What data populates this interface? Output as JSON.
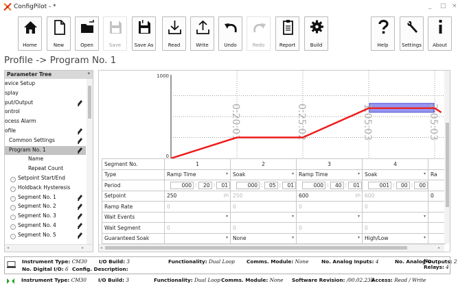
{
  "window": {
    "title": "ConfigPilot - *",
    "minimize": "_",
    "maximize": "□",
    "close": "×"
  },
  "toolbar": {
    "home": "Home",
    "new": "New",
    "open": "Open",
    "save": "Save",
    "save_as": "Save As",
    "read": "Read",
    "write": "Write",
    "undo": "Undo",
    "redo": "Redo",
    "report": "Report",
    "build": "Build",
    "help": "Help",
    "settings": "Settings",
    "about": "About"
  },
  "page_title": "Profile -> Program No. 1",
  "tree": {
    "header": "Parameter Tree",
    "pin": "ᵠ",
    "items": [
      {
        "label": "evice Setup",
        "editable": false
      },
      {
        "label": "splay",
        "editable": false
      },
      {
        "label": "put/Output",
        "editable": true
      },
      {
        "label": "ontrol",
        "editable": false
      },
      {
        "label": "ocess Alarm",
        "editable": false
      },
      {
        "label": "ofile",
        "editable": true
      },
      {
        "label": "Common Settings",
        "editable": true
      },
      {
        "label": "Program No. 1",
        "editable": true,
        "selected": true
      },
      {
        "label": "Name",
        "editable": false
      },
      {
        "label": "Repeat Count",
        "editable": false
      },
      {
        "label": "Setpoint Start/End",
        "editable": false,
        "expander": true
      },
      {
        "label": "Holdback Hysteresis",
        "editable": false,
        "expander": true
      },
      {
        "label": "Segment No. 1",
        "editable": true,
        "expander": true
      },
      {
        "label": "Segment No. 2",
        "editable": true,
        "expander": true
      },
      {
        "label": "Segment No. 3",
        "editable": true,
        "expander": true
      },
      {
        "label": "Segment No. 4",
        "editable": true,
        "expander": true
      },
      {
        "label": "Segment No. 5",
        "editable": true,
        "expander": true
      }
    ]
  },
  "chart_data": {
    "type": "line",
    "y_top_label": "1000",
    "y_bottom_label": "0",
    "series": [
      {
        "x": [
          0,
          1,
          2,
          3,
          4,
          4.1
        ],
        "y": [
          0,
          250,
          250,
          600,
          600,
          550
        ]
      }
    ],
    "x_tick_labels": [
      "0:20:01",
      "0:25:02",
      "1:05:03",
      "2:05:03"
    ],
    "highlight_segment": 4
  },
  "grid": {
    "row_headers": [
      "Segment No.",
      "Type",
      "Period",
      "Setpoint",
      "Ramp Rate",
      "Wait Events",
      "Wait Segment",
      "Guaranteed Soak"
    ],
    "columns": [
      {
        "no": "1",
        "type": "Ramp Time",
        "period": [
          "000",
          "20",
          "01"
        ],
        "setpoint": "250",
        "setpoint_unit": "l/h",
        "ramp_rate": "0",
        "wait_events": "",
        "wait_segment": "0",
        "guaranteed_soak": ""
      },
      {
        "no": "2",
        "type": "Soak",
        "period": [
          "000",
          "05",
          "01"
        ],
        "setpoint": "250",
        "setpoint_unit": "",
        "ramp_rate": "0",
        "wait_events": "",
        "wait_segment": "0",
        "guaranteed_soak": "None"
      },
      {
        "no": "3",
        "type": "Ramp Time",
        "period": [
          "000",
          "40",
          "01"
        ],
        "setpoint": "600",
        "setpoint_unit": "l/h",
        "ramp_rate": "0",
        "wait_events": "",
        "wait_segment": "0",
        "guaranteed_soak": ""
      },
      {
        "no": "4",
        "type": "Soak",
        "period": [
          "001",
          "00",
          "00"
        ],
        "setpoint": "600",
        "setpoint_unit": "",
        "ramp_rate": "0",
        "wait_events": "",
        "wait_segment": "0",
        "guaranteed_soak": "High/Low"
      },
      {
        "no": "",
        "type": "Ra",
        "period": [
          "",
          "",
          ""
        ],
        "setpoint": "0",
        "setpoint_unit": "",
        "ramp_rate": "",
        "wait_events": "",
        "wait_segment": "",
        "guaranteed_soak": ""
      }
    ]
  },
  "status1": {
    "instrument_type_label": "Instrument Type:",
    "instrument_type": "CM30",
    "io_build_label": "I/O Build:",
    "io_build": "3",
    "functionality_label": "Functionality:",
    "functionality": "Dual Loop",
    "comms_label": "Comms. Module:",
    "comms": "None",
    "analog_inputs_label": "No. Analog Inputs:",
    "analog_inputs": "4",
    "analog_outputs_label": "No. Analog Outputs:",
    "analog_outputs": "2",
    "relays_label": "No. Relays:",
    "relays": "4",
    "digital_io_label": "No. Digital I/O:",
    "digital_io": "6",
    "config_desc_label": "Config. Description:"
  },
  "status2": {
    "instrument_type_label": "Instrument Type:",
    "instrument_type": "CM30",
    "io_build_label": "I/O Build:",
    "io_build": "3",
    "functionality_label": "Functionality:",
    "functionality": "Dual Loop",
    "comms_label": "Comms. Module:",
    "comms": "None",
    "software_label": "Software Revision:",
    "software": "/00.02.23E",
    "access_label": "Access:",
    "access": "Read / Write"
  }
}
